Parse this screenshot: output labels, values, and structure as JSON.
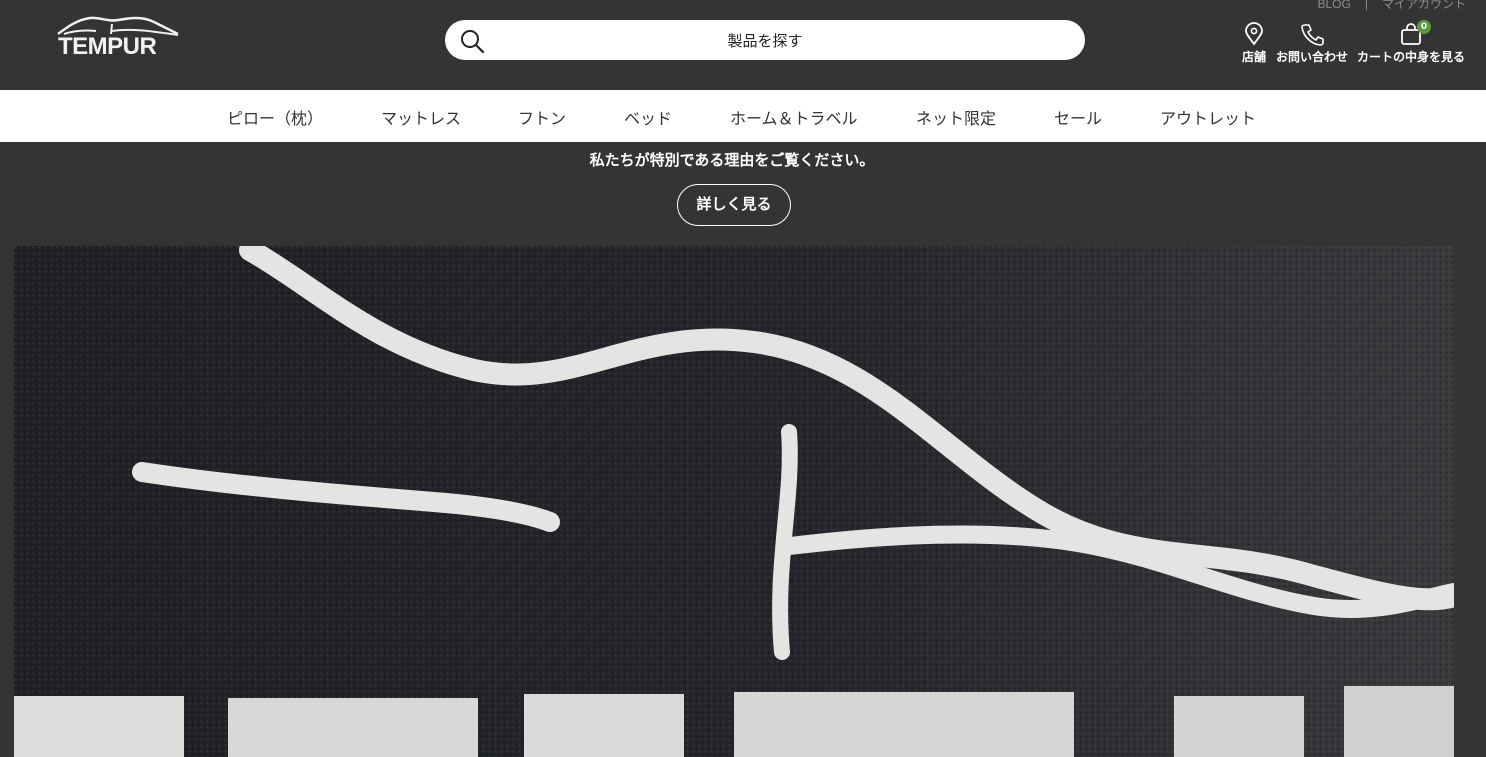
{
  "brand": {
    "logo_text": "TEMPUR"
  },
  "top_links": {
    "blog": "BLOG",
    "separator": "|",
    "account": "マイアカウント"
  },
  "search": {
    "placeholder": "製品を探す"
  },
  "header_icons": {
    "store": {
      "label": "店舗",
      "icon": "location-pin-icon"
    },
    "contact": {
      "label": "お問い合わせ",
      "icon": "phone-icon"
    },
    "cart": {
      "label": "カートの中身を見る",
      "icon": "shopping-bag-icon",
      "count": "0"
    }
  },
  "nav": {
    "items": [
      "ピロー（枕）",
      "マットレス",
      "フトン",
      "ベッド",
      "ホーム＆トラベル",
      "ネット限定",
      "セール",
      "アウトレット"
    ]
  },
  "promo": {
    "tagline": "私たちが特別である理由をご覧ください。",
    "button": "詳しく見る"
  },
  "hero": {
    "image": "embroidered-tempur-logo-closeup"
  },
  "colors": {
    "header_bg": "#333433",
    "nav_bg": "#ffffff",
    "badge": "#5b9a3c"
  }
}
